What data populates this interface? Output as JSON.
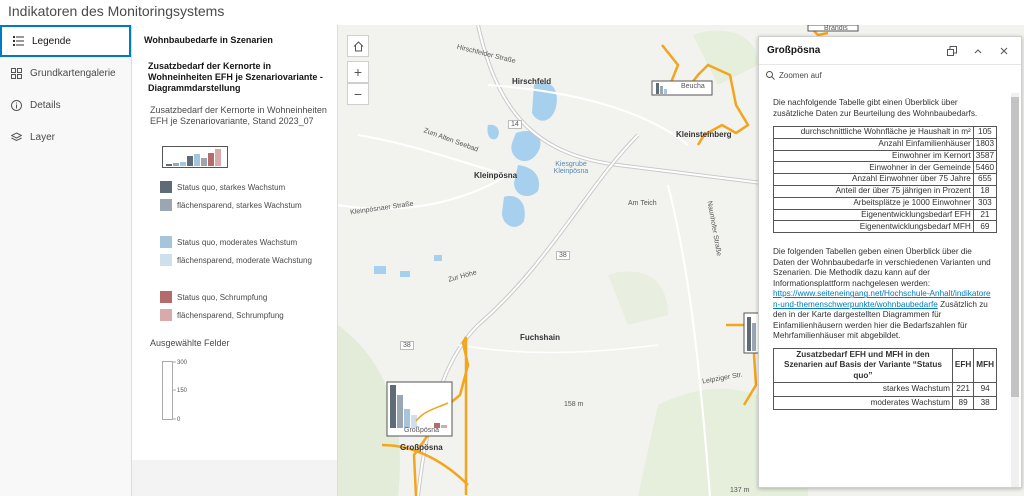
{
  "app": {
    "title": "Indikatoren des Monitoringsystems"
  },
  "nav": {
    "items": [
      {
        "label": "Legende",
        "icon": "legend-icon"
      },
      {
        "label": "Grundkartengalerie",
        "icon": "basemap-gallery-icon"
      },
      {
        "label": "Details",
        "icon": "info-icon"
      },
      {
        "label": "Layer",
        "icon": "layers-icon"
      }
    ]
  },
  "legend": {
    "panel_title": "Wohnbaubedarfe in Szenarien",
    "layer_title": "Zusatzbedarf der Kernorte in Wohneinheiten EFH je Szenariovariante - Diagrammdarstellung",
    "subtitle": "Zusatzbedarf der Kernorte in Wohneinheiten EFH je Szenariovariante, Stand 2023_07",
    "entries": [
      {
        "label": "Status quo, starkes Wachstum",
        "color": "#5f6b77"
      },
      {
        "label": "flächensparend, starkes Wachstum",
        "color": "#9aa7b2"
      },
      {
        "label": "Status quo, moderates Wachstum",
        "color": "#a6c4dc"
      },
      {
        "label": "flächensparend, moderate Wachstung",
        "color": "#cfe0ec"
      },
      {
        "label": "Status quo, Schrumpfung",
        "color": "#b56b6b"
      },
      {
        "label": "flächensparend, Schrumpfung",
        "color": "#d9aaaa"
      }
    ],
    "fields_title": "Ausgewählte Felder",
    "scale": {
      "max": "300",
      "mid": "150",
      "min": "0"
    }
  },
  "map": {
    "labels": {
      "hirschfeld": "Hirschfeld",
      "kleinpoesna": "Kleinpösna",
      "kleinsteinberg": "Kleinsteinberg",
      "fuchshain": "Fuchshain",
      "grosspoesna": "Großpösna",
      "kiesgrube": "Kiesgrube Kleinpösna",
      "am_teich": "Am Teich",
      "zur_hoehe": "Zur Höhe",
      "zum_alten": "Zum Alten Seebad",
      "kleinp_str": "Kleinpösnaer Straße",
      "hirsch_str": "Hirschfelder Straße",
      "naunhofer": "Naunhofer Straße",
      "leipz_str": "Leipziger Str.",
      "route14": "14",
      "route38a": "38",
      "route38b": "38",
      "elev158": "158 m",
      "elev137": "137 m",
      "brandis": "Brandis",
      "beucha": "Beucha",
      "chart_label": "Großpösna"
    },
    "controls": {
      "zoom_in": "+",
      "zoom_out": "−"
    }
  },
  "popup": {
    "title": "Großpösna",
    "zoom_label": "Zoomen auf",
    "intro": "Die nachfolgende Tabelle gibt einen Überblick über zusätzliche Daten zur Beurteilung des Wohnbaubedarfs.",
    "stats": [
      {
        "label": "durchschnittliche Wohnfläche je Haushalt in m²",
        "value": "105"
      },
      {
        "label": "Anzahl Einfamilienhäuser",
        "value": "1803"
      },
      {
        "label": "Einwohner im Kernort",
        "value": "3587"
      },
      {
        "label": "Einwohner in der Gemeinde",
        "value": "5460"
      },
      {
        "label": "Anzahl Einwohner über 75 Jahre",
        "value": "655"
      },
      {
        "label": "Anteil der über 75 jährigen in Prozent",
        "value": "18"
      },
      {
        "label": "Arbeitsplätze je 1000 Einwohner",
        "value": "303"
      },
      {
        "label": "Eigenentwicklungsbedarf EFH",
        "value": "21"
      },
      {
        "label": "Eigenentwicklungsbedarf MFH",
        "value": "69"
      }
    ],
    "text2": "Die folgenden Tabellen geben einen Überblick über die Daten der Wohnbaubedarfe in verschiedenen Varianten und Szenarien. Die Methodik dazu kann auf der Informationsplattform nachgelesen werden:",
    "link": "https://www.seiteneingang.net/Hochschule-Anhalt/indikatoren-und-themenschwerpunkte/wohnbaubedarfe",
    "text3": "Zusätzlich zu den in der Karte dargestellten Diagrammen für Einfamilienhäusern werden hier die Bedarfszahlen für Mehrfamilienhäuser mit abgebildet.",
    "scenario_table": {
      "header": "Zusatzbedarf EFH und MFH in den Szenarien auf Basis der Variante “Status quo”",
      "col_efh": "EFH",
      "col_mfh": "MFH",
      "rows": [
        {
          "label": "starkes Wachstum",
          "efh": "221",
          "mfh": "94"
        },
        {
          "label": "moderates Wachstum",
          "efh": "89",
          "mfh": "38"
        }
      ]
    }
  }
}
